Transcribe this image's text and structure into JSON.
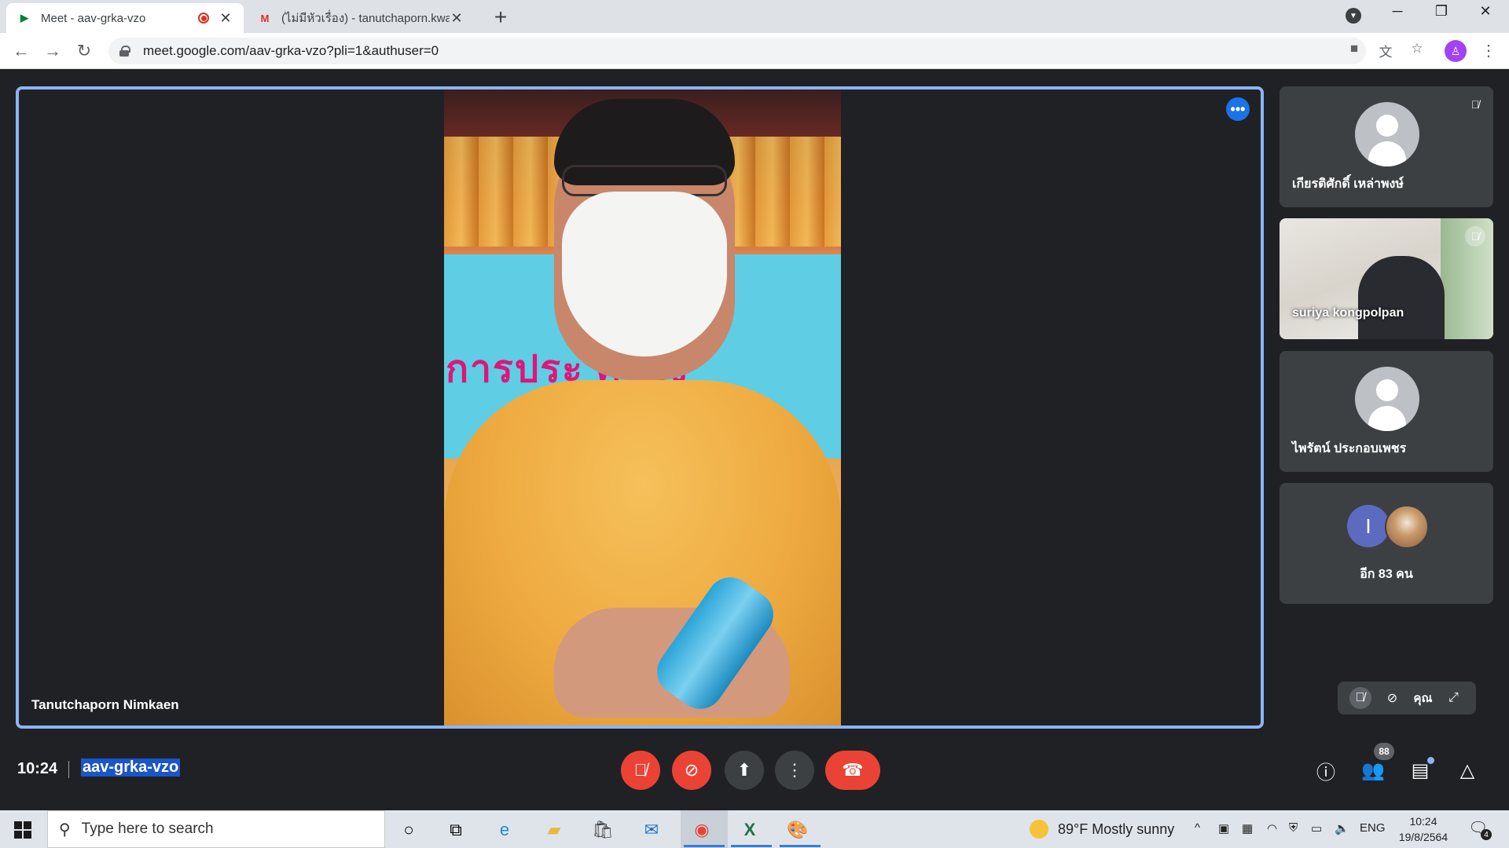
{
  "browser": {
    "tabs": [
      {
        "title": "Meet - aav-grka-vzo",
        "favicon": "meet-icon",
        "recording": true
      },
      {
        "title": "(ไม่มีหัวเรื่อง) - tanutchaporn.kwan",
        "favicon": "gmail-icon"
      }
    ],
    "url": "meet.google.com/aav-grka-vzo?pli=1&authuser=0"
  },
  "meet": {
    "main_speaker": "Tanutchaporn Nimkaen",
    "banner_text": "การประ   ครอง",
    "participants": [
      {
        "name": "เกียรติศักดิ์ เหล่าพงษ์",
        "muted": true,
        "video": false
      },
      {
        "name": "suriya kongpolpan",
        "muted": true,
        "video": true
      },
      {
        "name": "ไพรัตน์ ประกอบเพชร",
        "muted": false,
        "video": false
      }
    ],
    "others": {
      "initial": "I",
      "label": "อีก 83 คน"
    },
    "self_label": "คุณ",
    "time": "10:24",
    "meeting_code": "aav-grka-vzo",
    "participant_count": "88"
  },
  "taskbar": {
    "search_placeholder": "Type here to search",
    "weather": "89°F  Mostly sunny",
    "language": "ENG",
    "time": "10:24",
    "date": "19/8/2564",
    "notification_count": "4"
  },
  "colors": {
    "accent": "#8ab4f8",
    "danger": "#ea4335",
    "background": "#202124",
    "tile": "#3c4043"
  }
}
